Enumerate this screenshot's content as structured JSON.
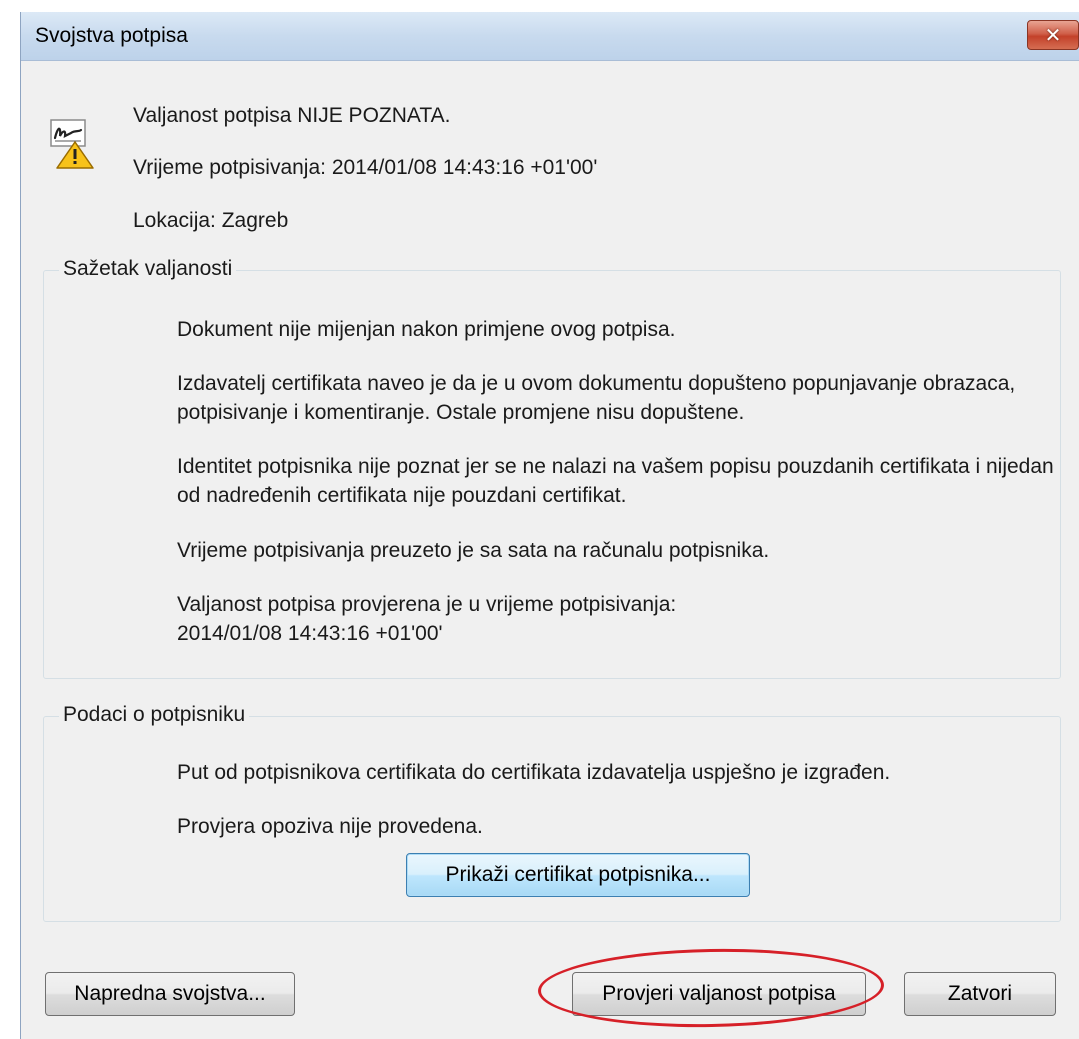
{
  "window": {
    "title": "Svojstva potpisa",
    "close_glyph": "✕"
  },
  "header": {
    "icon": "signature-warning-icon",
    "status": "Valjanost potpisa NIJE POZNATA.",
    "signing_time_label": "Vrijeme potpisivanja:",
    "signing_time_value": "2014/01/08 14:43:16 +01'00'",
    "location_label": "Lokacija:",
    "location_value": "Zagreb"
  },
  "validity_summary": {
    "label": "Sažetak valjanosti",
    "paragraphs": [
      "Dokument nije mijenjan nakon primjene ovog potpisa.",
      "Izdavatelj certifikata naveo je da je u ovom dokumentu dopušteno popunjavanje obrazaca, potpisivanje i komentiranje.  Ostale promjene nisu dopuštene.",
      "Identitet potpisnika nije poznat jer se ne nalazi na vašem popisu pouzdanih certifikata i nijedan od nadređenih certifikata nije pouzdani certifikat.",
      "Vrijeme potpisivanja preuzeto je sa sata na računalu potpisnika.",
      "Valjanost potpisa provjerena je u vrijeme potpisivanja:",
      "2014/01/08 14:43:16 +01'00'"
    ]
  },
  "signer_info": {
    "label": "Podaci o potpisniku",
    "paragraphs": [
      "Put od potpisnikova certifikata do certifikata izdavatelja uspješno je izgrađen.",
      "Provjera opoziva nije provedena."
    ],
    "show_certificate_button": "Prikaži certifikat potpisnika..."
  },
  "footer": {
    "advanced_button": "Napredna svojstva...",
    "validate_button": "Provjeri valjanost potpisa",
    "close_button": "Zatvori"
  },
  "colors": {
    "highlight_circle": "#d62028",
    "titlebar": "#c8daee",
    "dialog_bg": "#f0f0f0"
  }
}
